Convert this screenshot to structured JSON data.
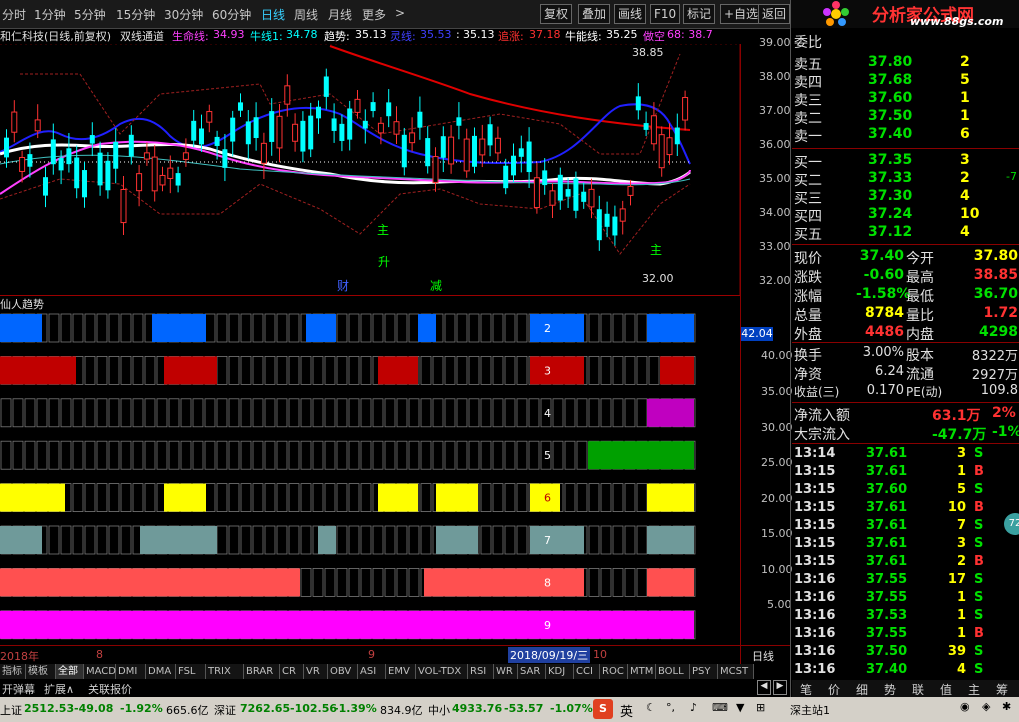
{
  "toolbar": {
    "periods": [
      "分时",
      "1分钟",
      "5分钟",
      "15分钟",
      "30分钟",
      "60分钟",
      "日线",
      "周线",
      "月线",
      "更多"
    ],
    "active_period": "日线",
    "more_arrow": ">",
    "buttons": [
      "复权",
      "叠加",
      "画线",
      "F10",
      "标记",
      "+自选",
      "返回"
    ]
  },
  "logo": {
    "title": "分析家公式网",
    "url": "www.88gs.com"
  },
  "info": {
    "stock": "和仁科技(日线,前复权)",
    "indicator": "双线通道",
    "items": [
      {
        "label": "生命线:",
        "value": "34.93",
        "color": "#ff40ff"
      },
      {
        "label": "牛线1:",
        "value": "34.78",
        "color": "#00ffff"
      },
      {
        "label": "趋势:",
        "value": "35.13",
        "color": "#ffffff"
      },
      {
        "label": "灵线:",
        "value": "35.53",
        "color": "#4040ff"
      },
      {
        "label": ":",
        "value": "35.13",
        "color": "#ffffff"
      },
      {
        "label": "追涨:",
        "value": "37.18",
        "color": "#ff3030"
      },
      {
        "label": "牛能线:",
        "value": "35.25",
        "color": "#ffffff"
      },
      {
        "label": "做空",
        "value": "68: 38.7",
        "color": "#ff40ff"
      }
    ]
  },
  "price_axis": [
    "39.00",
    "38.00",
    "37.00",
    "36.00",
    "35.00",
    "34.00",
    "33.00",
    "32.00"
  ],
  "annotations": {
    "high": "38.85",
    "low": "32.00",
    "zhu1": "主",
    "zhu2": "主",
    "sheng": "升",
    "cai": "财",
    "jian": "减"
  },
  "sub_panel": {
    "title": "仙人趋势",
    "current": "42.04",
    "axis": [
      "40.00",
      "35.00",
      "30.00",
      "25.00",
      "20.00",
      "15.00",
      "10.00",
      "5.00"
    ],
    "rows": [
      {
        "num": "2",
        "color": "#0066ff"
      },
      {
        "num": "3",
        "color": "#c00000"
      },
      {
        "num": "4",
        "color": "#c000c0"
      },
      {
        "num": "5",
        "color": "#00a000"
      },
      {
        "num": "6",
        "color": "#ffff00"
      },
      {
        "num": "7",
        "color": "#6f9a9a"
      },
      {
        "num": "8",
        "color": "#ff5050"
      },
      {
        "num": "9",
        "color": "#ff00ff"
      }
    ]
  },
  "date_axis": {
    "year": "2018年",
    "m8": "8",
    "m9": "9",
    "cursor": "2018/09/19/三",
    "m10": "10",
    "period": "日线"
  },
  "indicators": [
    "指标",
    "模板",
    "全部",
    "MACD",
    "DMI",
    "DMA",
    "FSL",
    "TRIX",
    "BRAR",
    "CR",
    "VR",
    "OBV",
    "ASI",
    "EMV",
    "VOL-TDX",
    "RSI",
    "WR",
    "SAR",
    "KDJ",
    "CCI",
    "ROC",
    "MTM",
    "BOLL",
    "PSY",
    "MCST"
  ],
  "sub_tabs": [
    "开弹幕",
    "扩展∧",
    "关联报价"
  ],
  "quote": {
    "header": "委比",
    "asks": [
      {
        "label": "卖五",
        "price": "37.80",
        "vol": "2"
      },
      {
        "label": "卖四",
        "price": "37.68",
        "vol": "5"
      },
      {
        "label": "卖三",
        "price": "37.60",
        "vol": "1"
      },
      {
        "label": "卖二",
        "price": "37.50",
        "vol": "1"
      },
      {
        "label": "卖一",
        "price": "37.40",
        "vol": "6"
      }
    ],
    "bids": [
      {
        "label": "买一",
        "price": "37.35",
        "vol": "3"
      },
      {
        "label": "买二",
        "price": "37.33",
        "vol": "2",
        "extra": "-7"
      },
      {
        "label": "买三",
        "price": "37.30",
        "vol": "4"
      },
      {
        "label": "买四",
        "price": "37.24",
        "vol": "10"
      },
      {
        "label": "买五",
        "price": "37.12",
        "vol": "4"
      }
    ],
    "stats": [
      {
        "l1": "现价",
        "v1": "37.40",
        "l2": "今开",
        "v2": "37.80"
      },
      {
        "l1": "涨跌",
        "v1": "-0.60",
        "l2": "最高",
        "v2": "38.85"
      },
      {
        "l1": "涨幅",
        "v1": "-1.58%",
        "l2": "最低",
        "v2": "36.70"
      },
      {
        "l1": "总量",
        "v1": "8784",
        "l2": "量比",
        "v2": "1.72"
      },
      {
        "l1": "外盘",
        "v1": "4486",
        "l2": "内盘",
        "v2": "4298"
      }
    ],
    "stats2": [
      {
        "l1": "换手",
        "v1": "3.00%",
        "l2": "股本",
        "v2": "8322万"
      },
      {
        "l1": "净资",
        "v1": "6.24",
        "l2": "流通",
        "v2": "2927万"
      },
      {
        "l1": "收益(三)",
        "v1": "0.170",
        "l2": "PE(动)",
        "v2": "109.8"
      }
    ],
    "flow": [
      {
        "label": "净流入额",
        "v": "63.1万",
        "p": "2%"
      },
      {
        "label": "大宗流入",
        "v": "-47.7万",
        "p": "-1%"
      }
    ],
    "ticks": [
      {
        "t": "13:14",
        "p": "37.61",
        "v": "3",
        "d": "S"
      },
      {
        "t": "13:15",
        "p": "37.61",
        "v": "1",
        "d": "B"
      },
      {
        "t": "13:15",
        "p": "37.60",
        "v": "5",
        "d": "S"
      },
      {
        "t": "13:15",
        "p": "37.61",
        "v": "10",
        "d": "B"
      },
      {
        "t": "13:15",
        "p": "37.61",
        "v": "7",
        "d": "S"
      },
      {
        "t": "13:15",
        "p": "37.61",
        "v": "3",
        "d": "S"
      },
      {
        "t": "13:15",
        "p": "37.61",
        "v": "2",
        "d": "B"
      },
      {
        "t": "13:16",
        "p": "37.55",
        "v": "17",
        "d": "S"
      },
      {
        "t": "13:16",
        "p": "37.55",
        "v": "1",
        "d": "S"
      },
      {
        "t": "13:16",
        "p": "37.53",
        "v": "1",
        "d": "S"
      },
      {
        "t": "13:16",
        "p": "37.55",
        "v": "1",
        "d": "B"
      },
      {
        "t": "13:16",
        "p": "37.50",
        "v": "39",
        "d": "S"
      },
      {
        "t": "13:16",
        "p": "37.40",
        "v": "4",
        "d": "S"
      }
    ]
  },
  "right_tabs": [
    "笔",
    "价",
    "细",
    "势",
    "联",
    "值",
    "主",
    "筹"
  ],
  "status": {
    "sh_label": "上证",
    "sh_val": "2512.53",
    "sh_chg": "-49.08",
    "sh_pct": "-1.92%",
    "sh_amt": "665.6亿",
    "sz_label": "深证",
    "sz_val": "7262.65",
    "sz_chg": "-102.56",
    "sz_pct": "-1.39%",
    "sz_amt": "834.9亿",
    "zx_label": "中小",
    "zx_val": "4933.76",
    "zx_chg": "-53.57",
    "zx_pct": "-1.07%",
    "ime": "英",
    "station": "深主站1"
  },
  "colors": {
    "up": "#ff3232",
    "down": "#00ffff",
    "grid": "#8a0000",
    "bg": "#000000"
  }
}
